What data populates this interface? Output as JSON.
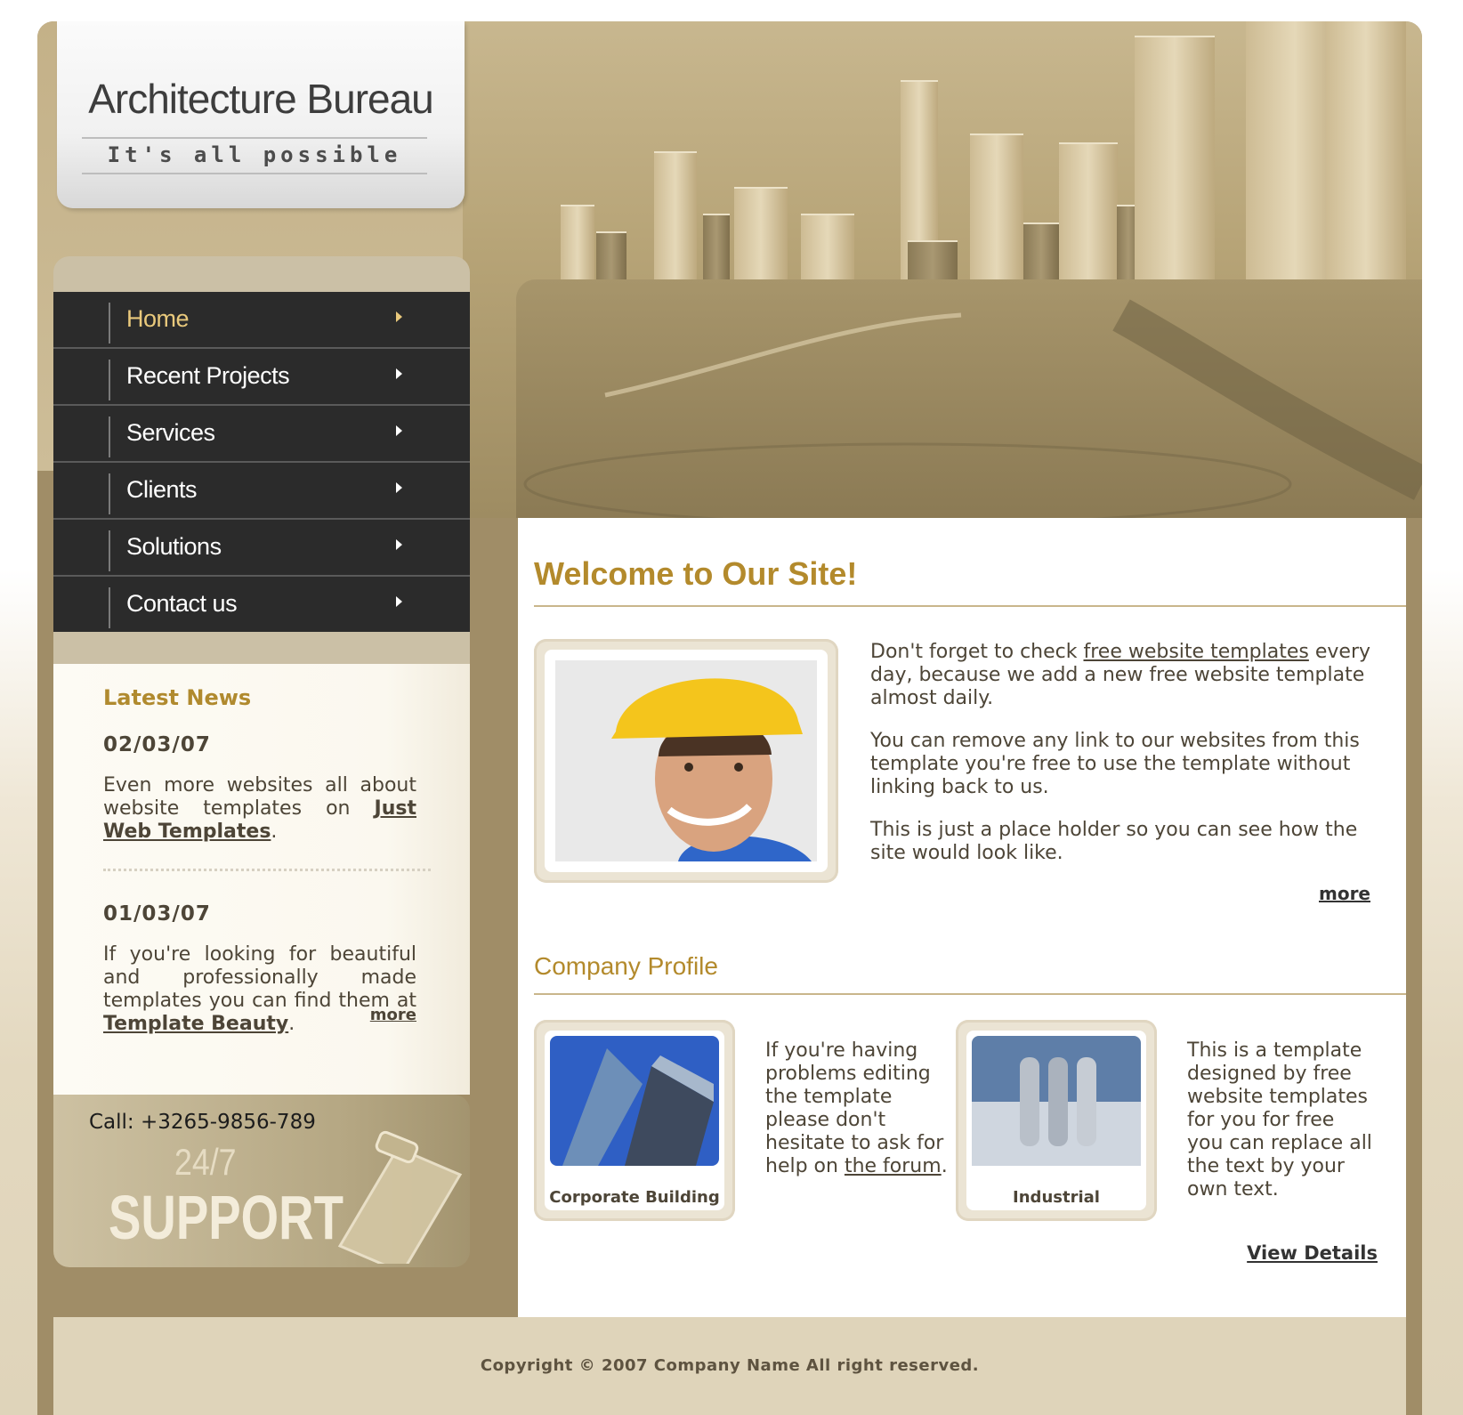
{
  "logo": {
    "title": "Architecture Bureau",
    "slogan": "It's all possible"
  },
  "nav": {
    "items": [
      {
        "label": "Home",
        "active": true
      },
      {
        "label": "Recent Projects"
      },
      {
        "label": "Services"
      },
      {
        "label": "Clients"
      },
      {
        "label": "Solutions"
      },
      {
        "label": "Contact us"
      }
    ]
  },
  "news": {
    "heading": "Latest News",
    "items": [
      {
        "date": "02/03/07",
        "text_before": "Even more websites all about website templates on ",
        "link": "Just Web Templates",
        "text_after": "."
      },
      {
        "date": "01/03/07",
        "text_before": "If you're looking for beautiful and professionally made templates you can find them at ",
        "link": "Template Beauty",
        "text_after": "."
      }
    ],
    "more": "more"
  },
  "support": {
    "call": "Call: +3265-9856-789",
    "hours": "24/7",
    "word": "SUPPORT"
  },
  "welcome": {
    "heading": "Welcome to Our Site!",
    "p1_before": "Don't forget to check ",
    "p1_link": "free website templates",
    "p1_after": " every day, because we add a new free website template almost daily.",
    "p2": "You can remove any link to our websites from this template you're free to use the template without linking back to us.",
    "p3": "This is just a place holder so you can see how the site would look like.",
    "more": "more"
  },
  "profile": {
    "heading": "Company Profile",
    "cards": [
      {
        "caption": "Corporate Building"
      },
      {
        "caption": "Industrial"
      }
    ],
    "text1_before": "If you're having problems editing the template please don't hesitate to ask for help on ",
    "text1_link": "the forum",
    "text1_after": ".",
    "text2": "This is a template designed by free website templates for you for free you can replace all the text by your own text.",
    "view_details": "View Details"
  },
  "footer": {
    "copyright": "Copyright © 2007 Company Name All right reserved."
  },
  "colors": {
    "accent": "#b38a2c",
    "nav_bg": "#2b2b2b",
    "frame": "#a08d67",
    "tan": "#cbc0a6"
  }
}
